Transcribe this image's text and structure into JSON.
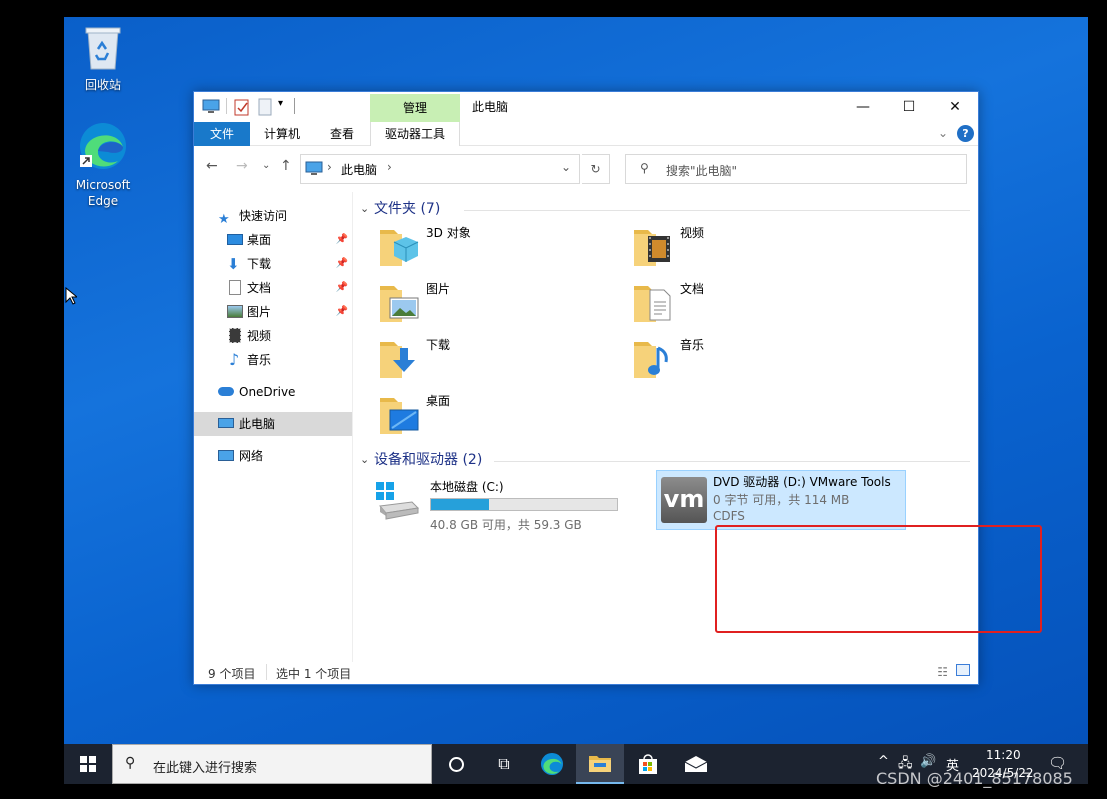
{
  "desktop": {
    "icons": [
      {
        "label": "回收站"
      },
      {
        "label_line1": "Microsoft",
        "label_line2": "Edge"
      }
    ]
  },
  "window": {
    "title": "此电脑",
    "manage_tab": "管理",
    "ribbon_tabs": {
      "file": "文件",
      "computer": "计算机",
      "view": "查看",
      "drive_tools": "驱动器工具"
    },
    "address": {
      "location": "此电脑"
    },
    "search": {
      "placeholder": "搜索\"此电脑\""
    },
    "nav": {
      "quick_access": "快速访问",
      "items": [
        {
          "label": "桌面",
          "pinned": true
        },
        {
          "label": "下载",
          "pinned": true
        },
        {
          "label": "文档",
          "pinned": true
        },
        {
          "label": "图片",
          "pinned": true
        },
        {
          "label": "视频",
          "pinned": false
        },
        {
          "label": "音乐",
          "pinned": false
        }
      ],
      "onedrive": "OneDrive",
      "this_pc": "此电脑",
      "network": "网络"
    },
    "folders_header": "文件夹 (7)",
    "folders": [
      "3D 对象",
      "视频",
      "图片",
      "文档",
      "下载",
      "音乐",
      "桌面"
    ],
    "drives_header": "设备和驱动器 (2)",
    "drives": [
      {
        "name": "本地磁盘 (C:)",
        "detail": "40.8 GB 可用，共 59.3 GB",
        "used_fraction": 0.31
      },
      {
        "name": "DVD 驱动器 (D:) VMware Tools",
        "detail": "0 字节 可用，共 114 MB",
        "fs": "CDFS",
        "logo_text": "vm"
      }
    ],
    "status": {
      "count": "9 个项目",
      "selected": "选中 1 个项目"
    }
  },
  "taskbar": {
    "search_placeholder": "在此键入进行搜索",
    "ime": "英",
    "time": "11:20",
    "date": "2024/5/22"
  },
  "watermark": "CSDN @2401_85178085",
  "colors": {
    "accent": "#1979ca",
    "manage_tab": "#c8efb4",
    "selection": "#cce8ff",
    "highlight_box": "#e02020"
  }
}
